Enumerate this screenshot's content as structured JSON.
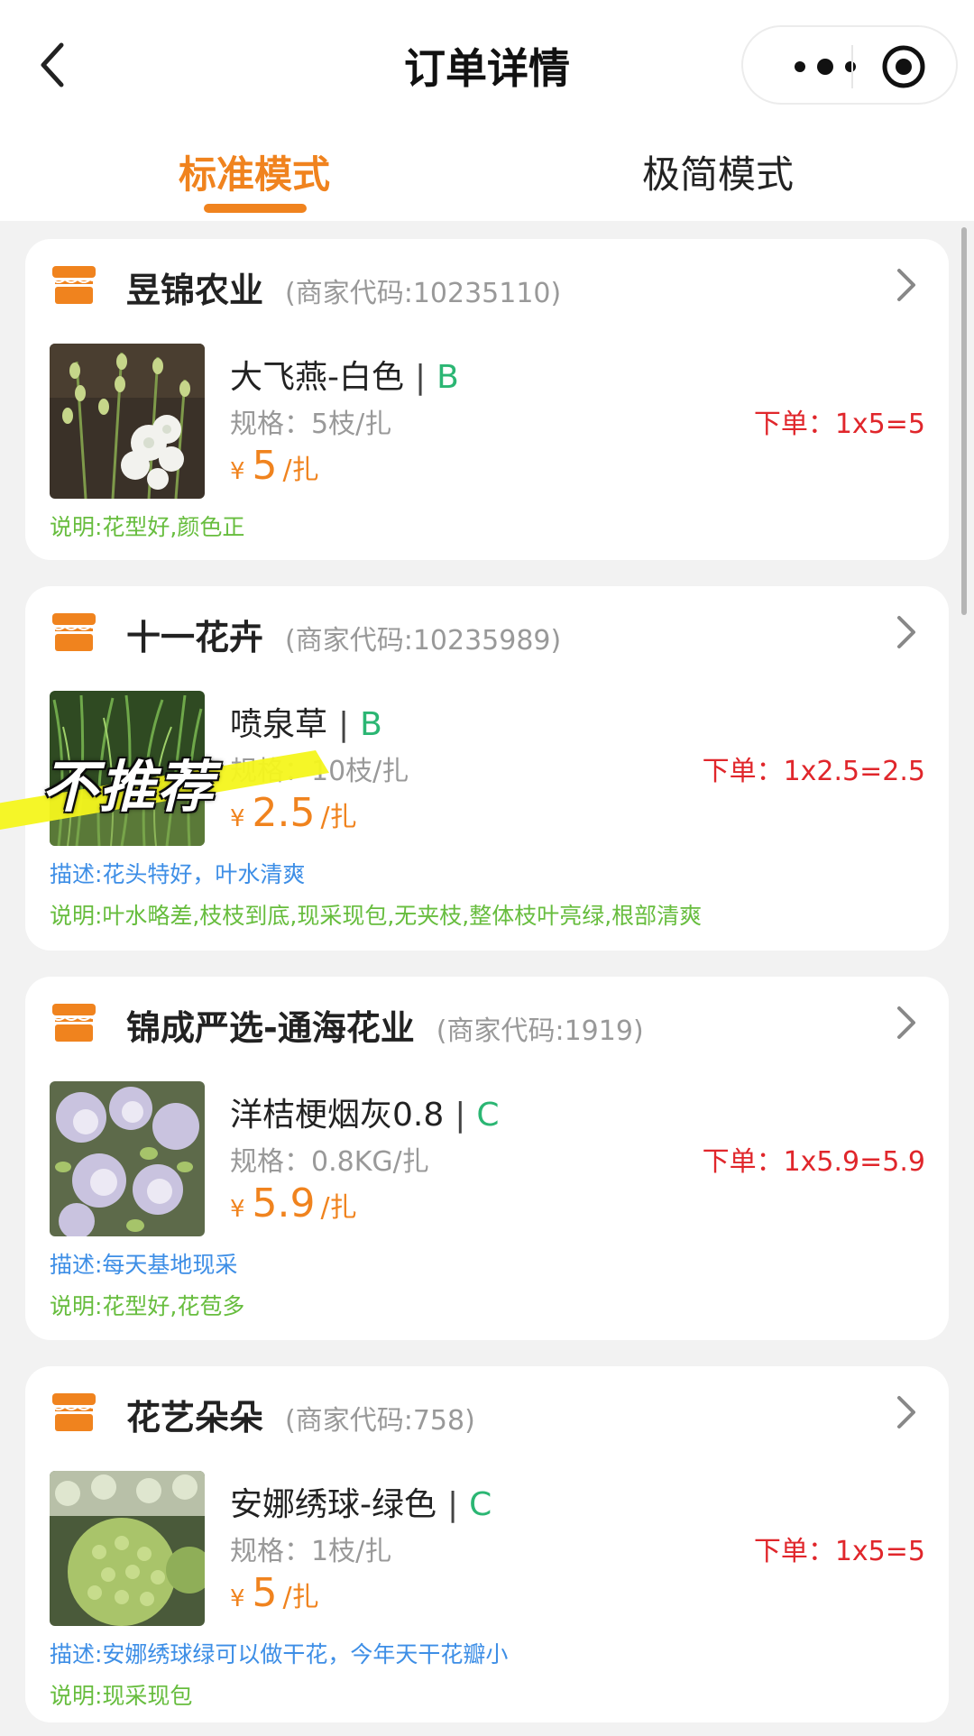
{
  "nav": {
    "title": "订单详情"
  },
  "tabs": [
    {
      "label": "标准模式",
      "active": true
    },
    {
      "label": "极简模式",
      "active": false
    }
  ],
  "colors": {
    "accent": "#f0831e",
    "order_red": "#e0262b",
    "grade_green": "#2bb673",
    "desc_blue": "#3d8ee6",
    "note_green": "#67bd3e"
  },
  "overlay": {
    "stamp_text": "不推荐"
  },
  "shops": [
    {
      "name": "昱锦农业",
      "code": "(商家代码:10235110)",
      "product": {
        "name": "大飞燕-白色",
        "sep": "|",
        "grade": "B",
        "spec": "规格：5枝/扎",
        "order": "下单：1x5=5",
        "currency": "¥",
        "price": "5",
        "unit": "/扎",
        "image_icon": "white-delphinium-photo"
      },
      "note": "说明:花型好,颜色正"
    },
    {
      "name": "十一花卉",
      "code": "(商家代码:10235989)",
      "product": {
        "name": "喷泉草",
        "sep": "|",
        "grade": "B",
        "spec": "规格：10枝/扎",
        "order": "下单：1x2.5=2.5",
        "currency": "¥",
        "price": "2.5",
        "unit": "/扎",
        "image_icon": "fountain-grass-photo"
      },
      "desc": "描述:花头特好，叶水清爽",
      "note": "说明:叶水略差,枝枝到底,现采现包,无夹枝,整体枝叶亮绿,根部清爽"
    },
    {
      "name": "锦成严选-通海花业",
      "code": "(商家代码:1919)",
      "product": {
        "name": "洋桔梗烟灰0.8",
        "sep": "|",
        "grade": "C",
        "spec": "规格：0.8KG/扎",
        "order": "下单：1x5.9=5.9",
        "currency": "¥",
        "price": "5.9",
        "unit": "/扎",
        "image_icon": "lisianthus-photo"
      },
      "desc": "描述:每天基地现采",
      "note": "说明:花型好,花苞多"
    },
    {
      "name": "花艺朵朵",
      "code": "(商家代码:758)",
      "product": {
        "name": "安娜绣球-绿色",
        "sep": "|",
        "grade": "C",
        "spec": "规格：1枝/扎",
        "order": "下单：1x5=5",
        "currency": "¥",
        "price": "5",
        "unit": "/扎",
        "image_icon": "green-hydrangea-photo"
      },
      "desc": "描述:安娜绣球绿可以做干花，今年天干花瓣小",
      "note": "说明:现采现包"
    }
  ]
}
